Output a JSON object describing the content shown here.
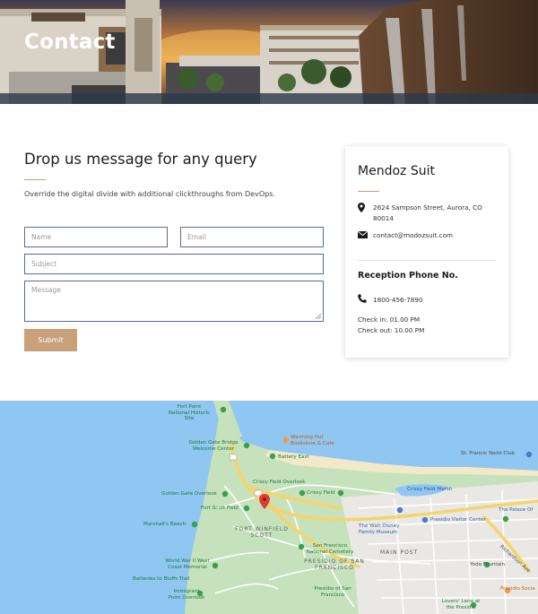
{
  "hero": {
    "title": "Contact"
  },
  "form": {
    "heading": "Drop us message for any query",
    "description": "Override the digital divide with additional clickthroughs from DevOps.",
    "name_placeholder": "Name",
    "email_placeholder": "Email",
    "subject_placeholder": "Subject",
    "message_placeholder": "Message",
    "submit_label": "Submit"
  },
  "info_card": {
    "title": "Mendoz Suit",
    "address_line1": "2624 Sampson Street, Aurora, CO",
    "address_line2": "80014",
    "email": "contact@modozsuit.com",
    "phone_heading": "Reception Phone No.",
    "phone": "1800-456-7890",
    "check_in": "Check in: 01.00 PM",
    "check_out": "Check out: 10.00 PM",
    "accent_color": "#c8a07a"
  },
  "map": {
    "labels": {
      "fort_point": "Fort Point National Historic Site",
      "warming_hut": "Warming Hut Bookstore & Cafe",
      "golden_gate_bridge": "Golden Gate Bridge Welcome Center",
      "battery_east": "Battery East",
      "st_francis": "St. Francis Yacht Club",
      "crissy_overlook": "Crissy Field Overlook",
      "crissy_marsh": "Crissy Field Marsh",
      "crissy_field": "Crissy Field",
      "gg_overlook": "Golden Gate Overlook",
      "fort_scott": "Fort Scott Field",
      "palace": "The Palace Of",
      "walt_disney": "The Walt Disney Family Museum",
      "presidio_visitor": "Presidio Visitor Center",
      "marshalls_beach": "Marshall's Beach",
      "fort_winfield": "FORT WINFIELD SCOTT",
      "sf_cemetery": "San Francisco National Cemetery",
      "main_post": "MAIN POST",
      "presidio_sf": "PRESIDIO OF SAN FRANCISCO",
      "ww2_memorial": "World War II West Coast Memorial",
      "yoda_fountain": "Yoda Fountain",
      "batteries_bluffs": "Batteries to Bluffs Trail",
      "immigrant_point": "Immigrant Point Overlook",
      "presidio_of": "Presidio of San Francisco",
      "lovers_lane": "Lovers' Lane at the Presidio",
      "presidio_soc": "Presidio Socia",
      "richardson_ave": "Richardson Ave"
    }
  }
}
